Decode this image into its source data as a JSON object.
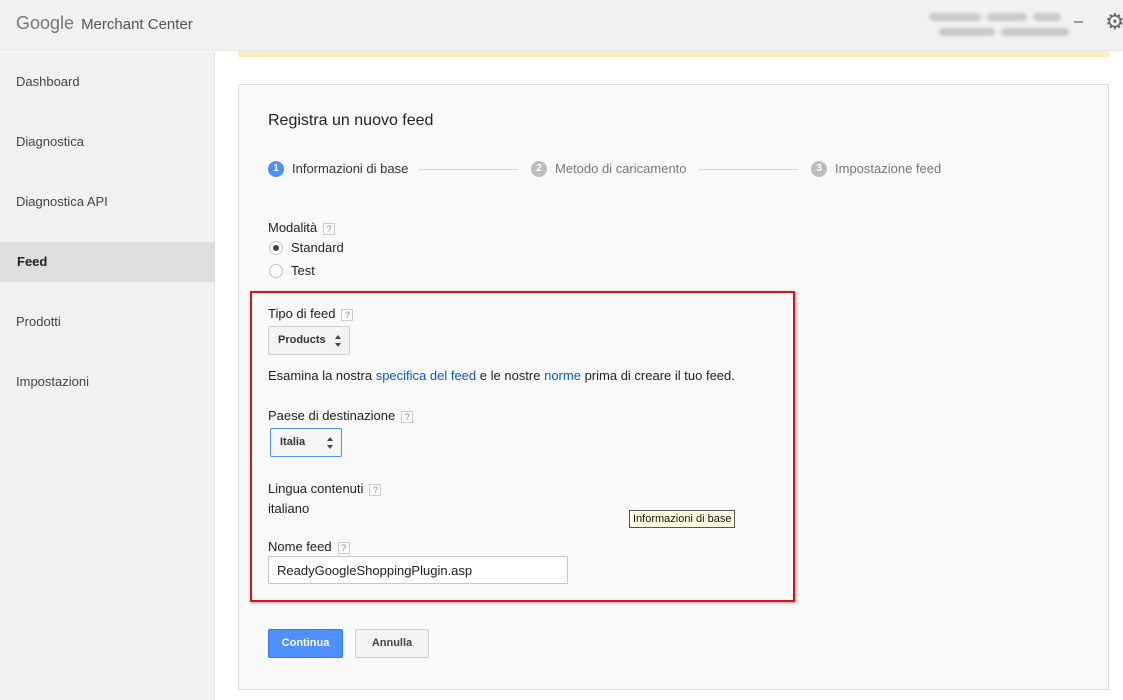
{
  "header": {
    "logo_google": "Google",
    "logo_product": "Merchant Center",
    "settings_icon": "gear-icon"
  },
  "sidebar": {
    "items": [
      {
        "label": "Dashboard",
        "active": false
      },
      {
        "label": "Diagnostica",
        "active": false
      },
      {
        "label": "Diagnostica API",
        "active": false
      },
      {
        "label": "Feed",
        "active": true
      },
      {
        "label": "Prodotti",
        "active": false
      },
      {
        "label": "Impostazioni",
        "active": false
      }
    ]
  },
  "form": {
    "title": "Registra un nuovo feed",
    "steps": [
      {
        "number": "1",
        "label": "Informazioni di base",
        "active": true
      },
      {
        "number": "2",
        "label": "Metodo di caricamento",
        "active": false
      },
      {
        "number": "3",
        "label": "Impostazione feed",
        "active": false
      }
    ],
    "help_glyph": "?",
    "mode": {
      "label": "Modalità",
      "options": [
        {
          "label": "Standard",
          "checked": true
        },
        {
          "label": "Test",
          "checked": false
        }
      ]
    },
    "feed_type": {
      "label": "Tipo di feed",
      "selected": "Products"
    },
    "info": {
      "prefix": "Esamina la nostra",
      "link1": "specifica del feed",
      "middle": "e le nostre",
      "link2": "norme",
      "suffix": "prima di creare il tuo feed."
    },
    "target_country": {
      "label": "Paese di destinazione",
      "selected": "Italia"
    },
    "content_language": {
      "label": "Lingua contenuti",
      "value": "italiano"
    },
    "feed_name": {
      "label": "Nome feed",
      "value": "ReadyGoogleShoppingPlugin.asp"
    },
    "tooltip": "Informazioni di base",
    "buttons": {
      "continue": "Continua",
      "cancel": "Annulla"
    }
  },
  "colors": {
    "accent": "#4d90fe",
    "link": "#1155cc",
    "highlight_border": "#d9131a",
    "notice": "#f9edbe"
  }
}
